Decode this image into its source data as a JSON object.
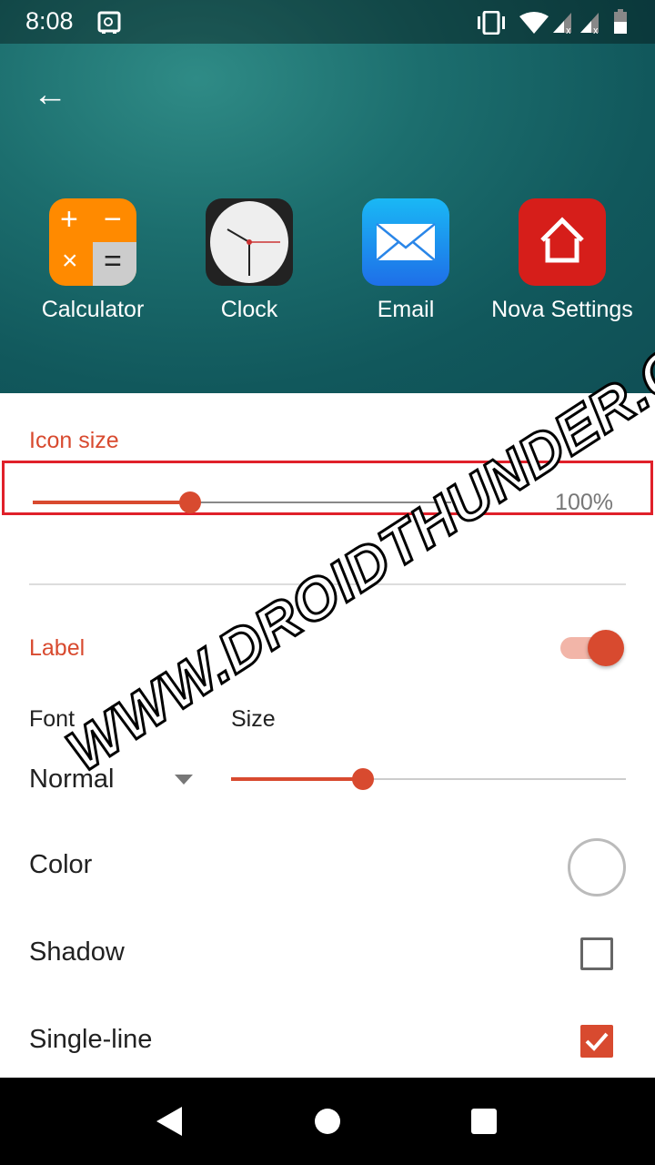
{
  "status_bar": {
    "time": "8:08"
  },
  "apps": [
    {
      "label": "Calculator"
    },
    {
      "label": "Clock"
    },
    {
      "label": "Email"
    },
    {
      "label": "Nova Settings"
    }
  ],
  "icon_size": {
    "title": "Icon size",
    "value_label": "100%",
    "slider_fraction": 0.37
  },
  "label_section": {
    "title": "Label",
    "toggle_on": true,
    "font_label": "Font",
    "size_label": "Size",
    "font_value": "Normal",
    "size_slider_fraction": 0.26,
    "color_label": "Color",
    "shadow_label": "Shadow",
    "shadow_checked": false,
    "single_line_label": "Single-line",
    "single_line_checked": true
  },
  "watermark": "WWW.DROIDTHUNDER.COM",
  "colors": {
    "accent": "#d84a2f",
    "highlight_box": "#e0202a"
  }
}
